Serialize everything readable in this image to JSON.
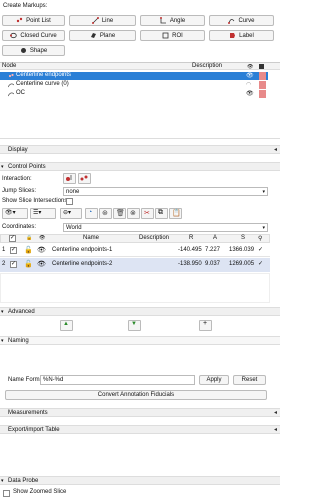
{
  "create_markups": {
    "label": "Create Markups:",
    "buttons": [
      {
        "label": "Point List",
        "color": "#c03030"
      },
      {
        "label": "Line",
        "color": "#c03030"
      },
      {
        "label": "Angle",
        "color": "#c03030"
      },
      {
        "label": "Curve",
        "color": "#c03030"
      },
      {
        "label": "Closed Curve",
        "color": "#c03030"
      },
      {
        "label": "Plane",
        "color": "#333333"
      },
      {
        "label": "ROI",
        "color": "#333333"
      },
      {
        "label": "Label",
        "color": "#c03030"
      },
      {
        "label": "Shape",
        "color": "#333333"
      }
    ]
  },
  "tree": {
    "headers": {
      "node": "Node",
      "description": "Description"
    },
    "rows": [
      {
        "label": "Centerline endpoints",
        "selected": true
      },
      {
        "label": "Centerline curve (0)",
        "selected": false
      },
      {
        "label": "OC",
        "selected": false
      }
    ]
  },
  "sections": {
    "display": "Display",
    "control_points": "Control Points",
    "advanced": "Advanced",
    "naming": "Naming",
    "measurements": "Measurements",
    "export_import": "Export/import Table",
    "data_probe": "Data Probe"
  },
  "control_points": {
    "interaction_label": "Interaction:",
    "jump_slices_label": "Jump Slices:",
    "jump_slices_value": "none",
    "show_intersections_label": "Show Slice Intersections:",
    "coordinates_label": "Coordinates:",
    "coordinates_value": "World",
    "table": {
      "headers": {
        "name": "Name",
        "description": "Description",
        "r": "R",
        "a": "A",
        "s": "S"
      },
      "rows": [
        {
          "index": "1",
          "name": "Centerline endpoints-1",
          "description": "",
          "r": "-140.495",
          "a": "7.227",
          "s": "1366.039"
        },
        {
          "index": "2",
          "name": "Centerline endpoints-2",
          "description": "",
          "r": "-138.950",
          "a": "9.037",
          "s": "1269.005"
        }
      ]
    }
  },
  "naming": {
    "name_format_label": "Name Format",
    "name_format_value": "%N-%d",
    "apply_label": "Apply",
    "reset_label": "Reset",
    "convert_label": "Convert Annotation Fiducials"
  },
  "data_probe": {
    "show_zoomed_label": "Show Zoomed Slice"
  }
}
